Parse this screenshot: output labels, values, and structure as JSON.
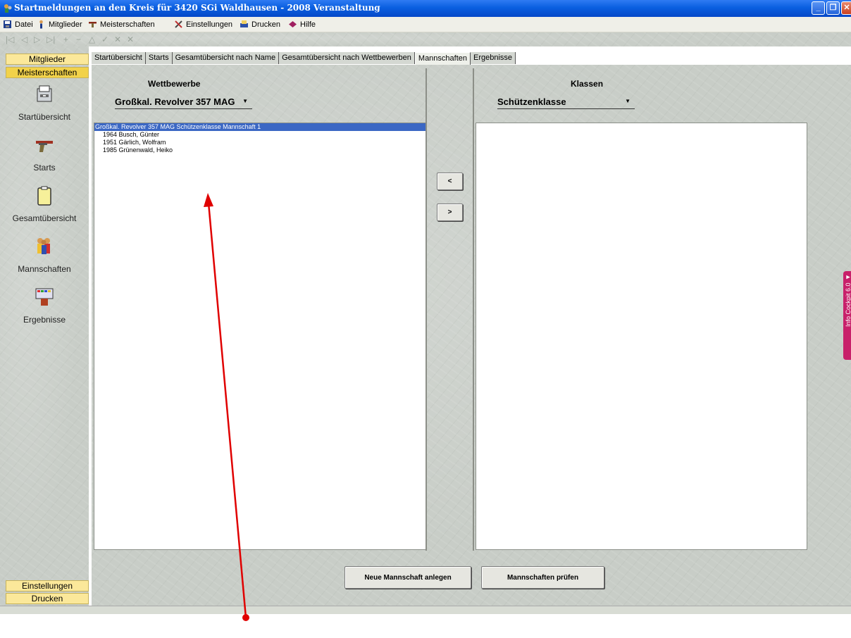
{
  "window": {
    "title": "Startmeldungen an den Kreis für 3420 SGi Waldhausen - 2008   Veranstaltung",
    "controls": [
      "minimize-button",
      "maximize-button",
      "close-button"
    ]
  },
  "menu": {
    "items": [
      {
        "label": "Datei",
        "icon": "save-disk-icon"
      },
      {
        "label": "Mitglieder",
        "icon": "person-icon"
      },
      {
        "label": "Meisterschaften",
        "icon": "pistol-icon"
      },
      {
        "label": "Einstellungen",
        "icon": "tools-icon"
      },
      {
        "label": "Drucken",
        "icon": "printer-icon"
      },
      {
        "label": "Hilfe",
        "icon": "help-book-icon"
      }
    ]
  },
  "sidebar": {
    "top_headers": [
      "Mitglieder",
      "Meisterschaften"
    ],
    "nav": [
      {
        "label": "Startübersicht",
        "icon": "file-drawer-icon"
      },
      {
        "label": "Starts",
        "icon": "pistol-icon"
      },
      {
        "label": "Gesamtübersicht",
        "icon": "clipboard-icon"
      },
      {
        "label": "Mannschaften",
        "icon": "team-people-icon"
      },
      {
        "label": "Ergebnisse",
        "icon": "scoreboard-icon"
      }
    ],
    "bottom_headers": [
      "Einstellungen",
      "Drucken"
    ]
  },
  "tabs": [
    {
      "label": "Startübersicht"
    },
    {
      "label": "Starts"
    },
    {
      "label": "Gesamtübersicht nach Name"
    },
    {
      "label": "Gesamtübersicht nach Wettbewerben"
    },
    {
      "label": "Mannschaften",
      "active": true
    },
    {
      "label": "Ergebnisse"
    }
  ],
  "left_panel": {
    "title": "Wettbewerbe",
    "selected_competition": "Großkal. Revolver 357 MAG",
    "list": [
      {
        "text": "Großkal. Revolver 357 MAG Schützenklasse   Mannschaft 1",
        "selected": true
      },
      {
        "text": "1964 Busch, Günter"
      },
      {
        "text": "1951 Gärlich, Wolfram"
      },
      {
        "text": "1985 Grünenwald, Heiko"
      }
    ]
  },
  "right_panel": {
    "title": "Klassen",
    "selected_class": "Schützenklasse",
    "list": []
  },
  "transfer_buttons": {
    "left": "<",
    "right": ">"
  },
  "actions": {
    "new_team": "Neue Mannschaft anlegen",
    "check_teams": "Mannschaften prüfen"
  },
  "side_tab": {
    "label": "Info Cockpit 6.0 ◄"
  },
  "colors": {
    "titlebar": "#0a5fe0",
    "selection": "#3b67c4",
    "sidebar_header": "#fbe89a",
    "info_tab": "#c8206a",
    "annotation_arrow": "#e00000"
  }
}
